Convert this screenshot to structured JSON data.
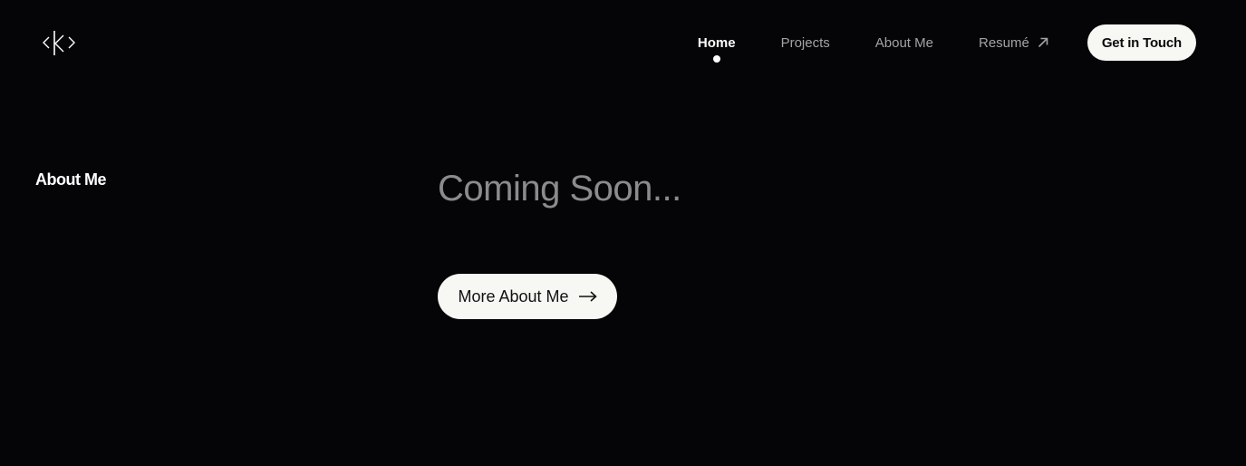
{
  "header": {
    "logo_icon": "kbd-brackets-logo",
    "nav": [
      {
        "label": "Home",
        "active": true
      },
      {
        "label": "Projects",
        "active": false
      },
      {
        "label": "About Me",
        "active": false
      },
      {
        "label": "Resumé",
        "active": false,
        "icon": "external-arrow-icon"
      }
    ],
    "cta_label": "Get in Touch"
  },
  "main": {
    "section_label": "About Me",
    "headline": "Coming Soon...",
    "more_button_label": "More About Me",
    "more_button_icon": "arrow-right-icon"
  },
  "colors": {
    "background": "#050407",
    "button_bg": "#f7f7f4",
    "muted_text": "#8b8b8e"
  }
}
